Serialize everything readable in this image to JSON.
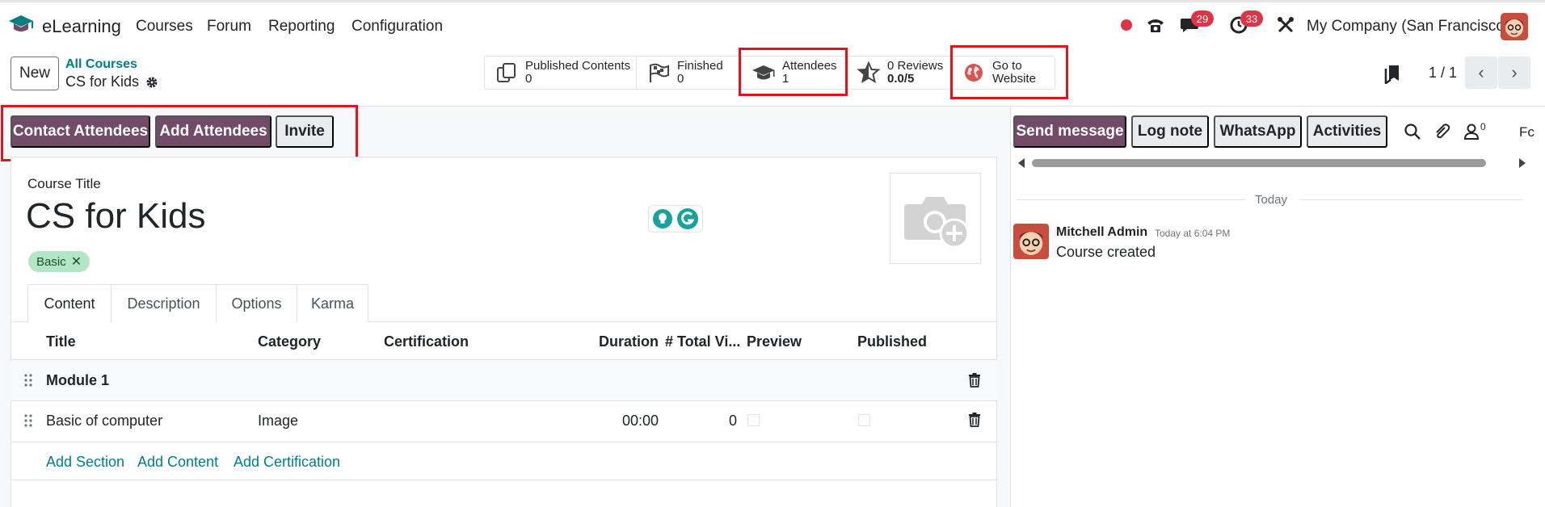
{
  "navbar": {
    "app_name": "eLearning",
    "menu": [
      "Courses",
      "Forum",
      "Reporting",
      "Configuration"
    ],
    "messages_badge": "29",
    "activities_badge": "33",
    "company": "My Company (San Francisco)",
    "icons": [
      "record-dot-icon",
      "phone-icon",
      "chat-icon",
      "clock-icon",
      "tools-icon"
    ]
  },
  "control_panel": {
    "new_label": "New",
    "breadcrumb_parent": "All Courses",
    "breadcrumb_current": "CS for Kids",
    "pager": "1 / 1",
    "pager_prev": "‹",
    "pager_next": "›"
  },
  "stats": {
    "published_label": "Published Contents",
    "published_value": "0",
    "finished_label": "Finished",
    "finished_value": "0",
    "attendees_label": "Attendees",
    "attendees_value": "1",
    "reviews_label": "0 Reviews",
    "reviews_value": "0.0/5",
    "website_label_1": "Go to",
    "website_label_2": "Website"
  },
  "status_buttons": {
    "contact": "Contact Attendees",
    "add": "Add Attendees",
    "invite": "Invite"
  },
  "form": {
    "title_label": "Course Title",
    "title": "CS for Kids",
    "tag": "Basic",
    "tag_remove": "✕",
    "tabs": [
      "Content",
      "Description",
      "Options",
      "Karma"
    ],
    "columns": [
      "Title",
      "Category",
      "Certification",
      "Duration",
      "# Total Vi...",
      "Preview",
      "Published"
    ],
    "section_title": "Module 1",
    "row": {
      "title": "Basic of computer",
      "category": "Image",
      "duration": "00:00",
      "total_views": "0"
    },
    "links": [
      "Add Section",
      "Add Content",
      "Add Certification"
    ]
  },
  "chatter": {
    "send_message": "Send message",
    "log_note": "Log note",
    "whatsapp": "WhatsApp",
    "activities": "Activities",
    "followers_count": "0",
    "truncated_label": "Fc",
    "date_separator": "Today",
    "message": {
      "author": "Mitchell Admin",
      "time": "Today at 6:04 PM",
      "body": "Course created"
    }
  },
  "colors": {
    "primary": "#714b67",
    "link": "#017e84",
    "badge": "#dc3545",
    "highlight": "#e3131b"
  }
}
